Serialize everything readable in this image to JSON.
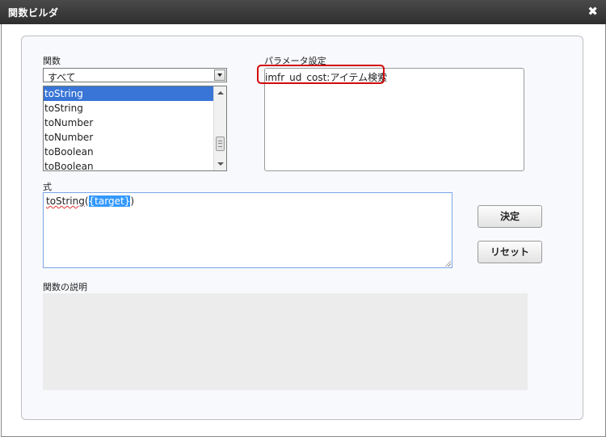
{
  "window": {
    "title": "関数ビルダ",
    "close_glyph": "✖"
  },
  "functions": {
    "label": "関数",
    "category_selected": "すべて",
    "list_items": [
      {
        "label": "toString",
        "selected": true
      },
      {
        "label": "toString",
        "selected": false
      },
      {
        "label": "toNumber",
        "selected": false
      },
      {
        "label": "toNumber",
        "selected": false
      },
      {
        "label": "toBoolean",
        "selected": false
      },
      {
        "label": "toBoolean",
        "selected": false
      }
    ]
  },
  "parameters": {
    "label": "パラメータ設定",
    "value": "imfr_ud_cost:アイテム検索",
    "highlight_color": "#d10b0b"
  },
  "expression": {
    "label": "式",
    "fn_name": "toString",
    "open_paren": "(",
    "selected_token": "{target}",
    "close_paren": ")"
  },
  "buttons": {
    "confirm": "決定",
    "reset": "リセット"
  },
  "description": {
    "label": "関数の説明",
    "text": ""
  },
  "colors": {
    "titlebar": "#3a3a3a",
    "selection": "#3875d7",
    "expression_border": "#7aa5e6"
  }
}
